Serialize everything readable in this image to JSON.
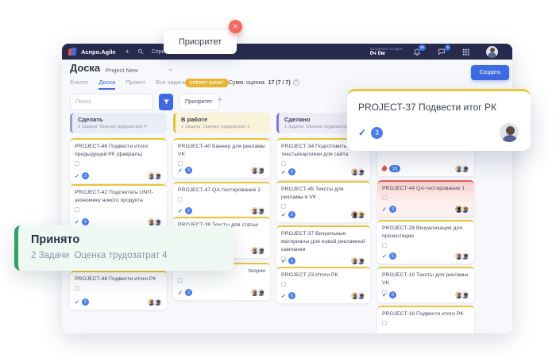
{
  "icons": {
    "check": "✓",
    "close": "✕",
    "plus": "+",
    "chevron_down": "⌄",
    "help": "?"
  },
  "colors": {
    "navy_bar": "#272a4a",
    "accent_blue": "#3e6be4",
    "card_border_yellow": "#ecc438",
    "todo_accent": "#94a5cc",
    "in_progress_accent": "#e8c041",
    "done_accent": "#8677d9",
    "accepted_accent": "#2fa163",
    "highlight_red": "#e0635a",
    "close_badge_red": "#f4695e"
  },
  "tooltip": {
    "label": "Приоритет"
  },
  "app_bar": {
    "brand": "Аспро.Agile",
    "menu_item": "Спринты",
    "time_label": "Затрачено сегодня",
    "time_value": "0ч 0м",
    "bell_badge": "26",
    "chat_badge": "5"
  },
  "toolbar": {
    "page_title": "Доска",
    "project_name": "Project New",
    "tabs": [
      "Бэклог",
      "Доска",
      "Проект",
      "Все задачи"
    ],
    "sprint_badge": "СПРИНТ НАЧАТ",
    "summary_label": "Сумм. оценка:",
    "summary_value": "17 (7 / 7)",
    "create_button": "Создать",
    "search_placeholder": "Поиск",
    "filter_chip": "Приоритет",
    "add_chip": "+"
  },
  "board": {
    "columns": [
      {
        "name": "Сделать",
        "meta": "2 Задачи  Оценка трудозатрат 4",
        "cards": [
          {
            "title": "PROJECT-46 Подвести итоги предыдущей РК (февраль)",
            "estimate": "3"
          },
          {
            "title": "PROJECT-42 Подсчитать UNIT-экономику нового продукта",
            "estimate": "2"
          },
          {
            "title": "PROJECT-48 Подвести итоги РК",
            "estimate": "2"
          }
        ]
      },
      {
        "name": "В работе",
        "meta": "1 Задача  Оценка трудозатрат 3",
        "cards": [
          {
            "title": "PROJECT-40 Баннер для рекламы VK",
            "estimate": "3"
          },
          {
            "title": "PROJECT-47 QA-тестирование 2",
            "estimate": "2"
          },
          {
            "title": "PROJECT-38 Тексты для статьи на",
            "estimate": ""
          },
          {
            "title": "теории",
            "estimate": "3"
          }
        ]
      },
      {
        "name": "Сделано",
        "meta": "1 Задача  Оценка трудозатрат",
        "cards": [
          {
            "title": "PROJECT-34 Подготовить тексты/картинки для сайта",
            "estimate": "5"
          },
          {
            "title": "PROJECT-45 Тексты для рекламы в VK",
            "estimate": "2"
          },
          {
            "title": "PROJECT-37 Визуальные материалы для новой рекламной кампании",
            "estimate": "3"
          },
          {
            "title": "PROJECT-23 Итоги РК",
            "estimate": "6"
          }
        ]
      },
      {
        "name": "",
        "meta": "",
        "cards": [
          {
            "title": "",
            "estimate": "",
            "pill": "15"
          },
          {
            "title": "PROJECT-44 QA-тестирование 1",
            "estimate": "3"
          },
          {
            "title": "PROJECT-28 Визуализация для презентации",
            "estimate": "5"
          },
          {
            "title": "PROJECT-19 Тексты для рекламы VK",
            "estimate": "5"
          },
          {
            "title": "PROJECT-16 Подвести итоги РК",
            "estimate": ""
          }
        ]
      }
    ]
  },
  "overlays": {
    "accepted": {
      "title": "Принято",
      "meta": "2 Задачи  Оценка трудозатрат 4"
    },
    "task": {
      "title": "PROJECT-37 Подвести итог РК",
      "estimate": "3"
    }
  }
}
